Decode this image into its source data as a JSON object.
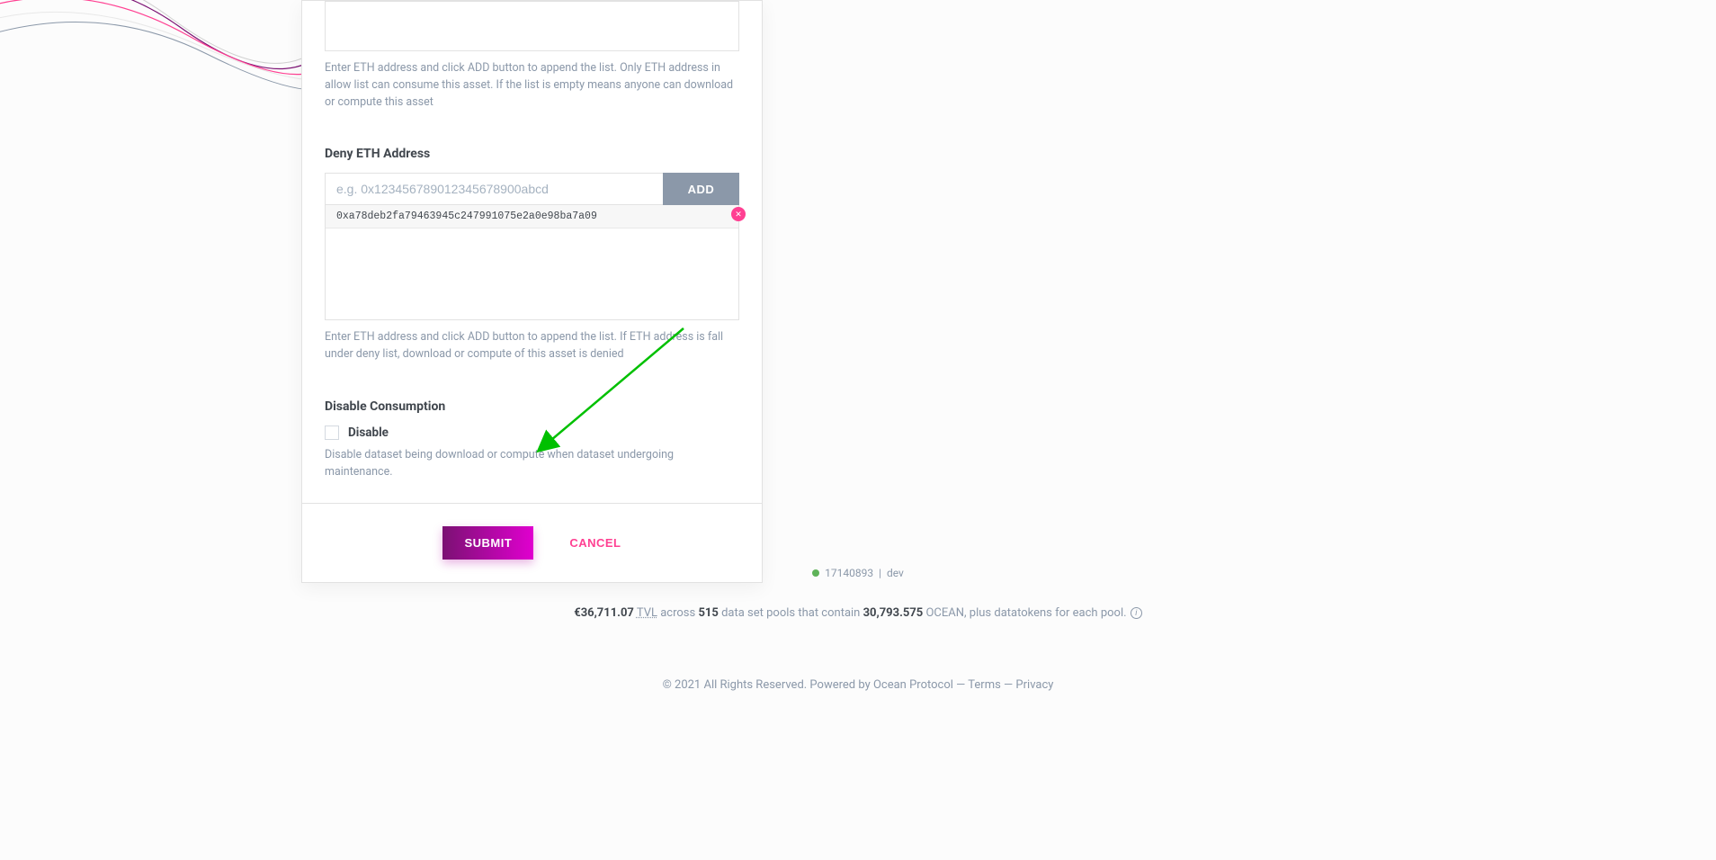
{
  "allow_section": {
    "help": "Enter ETH address and click ADD button to append the list. Only ETH address in allow list can consume this asset. If the list is empty means anyone can download or compute this asset"
  },
  "deny_section": {
    "label": "Deny ETH Address",
    "placeholder": "e.g. 0x123456789012345678900abcd",
    "add_label": "ADD",
    "addresses": [
      "0xa78deb2fa79463945c247991075e2a0e98ba7a09"
    ],
    "help": "Enter ETH address and click ADD button to append the list. If ETH address is fall under deny list, download or compute of this asset is denied"
  },
  "disable_section": {
    "label": "Disable Consumption",
    "checkbox_label": "Disable",
    "help": "Disable dataset being download or compute when dataset undergoing maintenance."
  },
  "actions": {
    "submit": "SUBMIT",
    "cancel": "CANCEL"
  },
  "footer": {
    "block_number": "17140893",
    "env": "dev",
    "stats": {
      "tvl_value": "€36,711.07",
      "tvl_label": "TVL",
      "text1": " across ",
      "pools": "515",
      "text2": " data set pools that contain ",
      "ocean": "30,793.575",
      "text3": " OCEAN, plus datatokens for each pool. "
    },
    "copyright": "© 2021 All Rights Reserved. Powered by ",
    "ocean_link": "Ocean Protocol",
    "dash": " — ",
    "terms": "Terms",
    "privacy": "Privacy"
  }
}
